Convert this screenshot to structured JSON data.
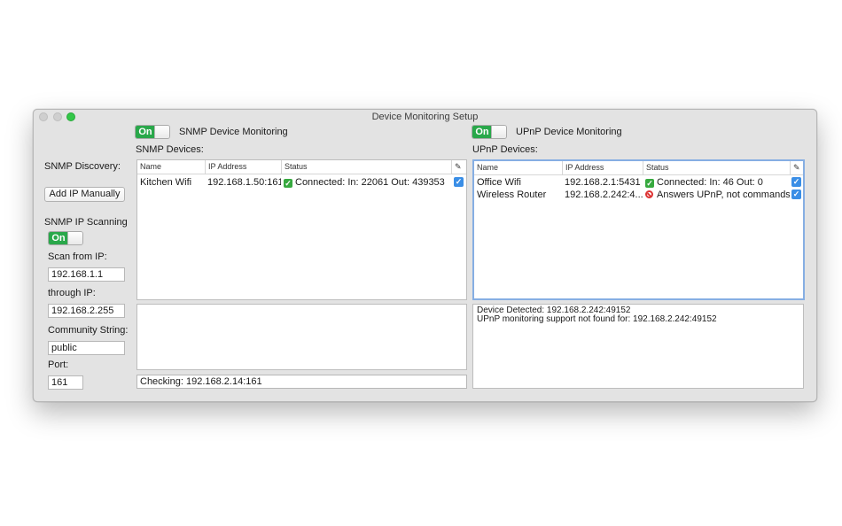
{
  "window": {
    "title": "Device Monitoring Setup"
  },
  "snmp": {
    "toggle_label": "On",
    "monitoring_label": "SNMP Device Monitoring",
    "devices_label": "SNMP Devices:",
    "columns": [
      "Name",
      "IP Address",
      "Status",
      "✎"
    ],
    "rows": [
      {
        "name": "Kitchen Wifi",
        "ip": "192.168.1.50:161",
        "status": "Connected: In: 22061  Out: 439353",
        "checked": true
      }
    ],
    "status_line": "Checking: 192.168.2.14:161"
  },
  "sidebar": {
    "discovery_label": "SNMP Discovery:",
    "add_ip_button": "Add IP Manually",
    "ip_scanning_label": "SNMP IP Scanning",
    "toggle_label": "On",
    "scan_from_label": "Scan from IP:",
    "scan_from_value": "192.168.1.1",
    "through_label": "through IP:",
    "through_value": "192.168.2.255",
    "community_label": "Community String:",
    "community_value": "public",
    "port_label": "Port:",
    "port_value": "161"
  },
  "upnp": {
    "toggle_label": "On",
    "monitoring_label": "UPnP Device Monitoring",
    "devices_label": "UPnP Devices:",
    "columns": [
      "Name",
      "IP Address",
      "Status",
      "✎"
    ],
    "rows": [
      {
        "name": "Office Wifi",
        "ip": "192.168.2.1:5431",
        "status": "Connected: In: 46  Out: 0",
        "status_type": "ok",
        "checked": true
      },
      {
        "name": "Wireless Router",
        "ip": "192.168.2.242:4...",
        "status": "Answers UPnP, not commands",
        "status_type": "error",
        "checked": true
      }
    ],
    "log": [
      "Device Detected: 192.168.2.242:49152",
      "UPnP monitoring support not found for: 192.168.2.242:49152"
    ]
  },
  "colors": {
    "toggle_on": "#29a84a",
    "checkbox": "#3a8ee6",
    "focus": "#86aee3"
  }
}
